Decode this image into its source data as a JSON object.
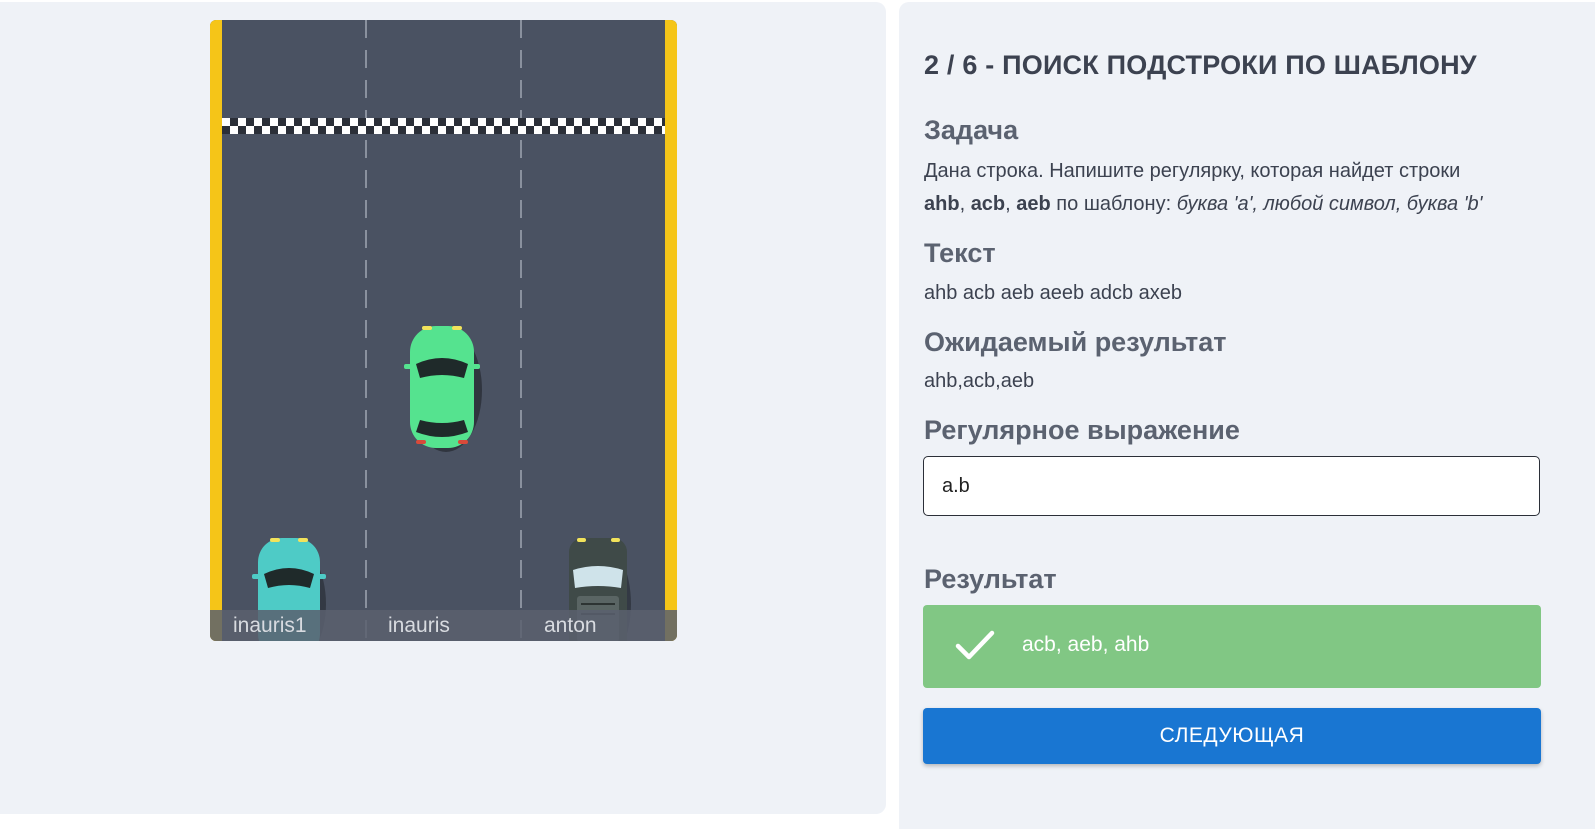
{
  "game": {
    "players": [
      {
        "name": "inauris1",
        "car_color": "#4ecbc6"
      },
      {
        "name": "inauris",
        "car_color": "#55e38f"
      },
      {
        "name": "anton",
        "car_color": "#3f4a48"
      }
    ],
    "colors": {
      "track": "#4a5262",
      "curb": "#f5c518"
    }
  },
  "task": {
    "title": "2 / 6 - ПОИСК ПОДСТРОКИ ПО ШАБЛОНУ",
    "task_heading": "Задача",
    "task_line1": "Дана строка. Напишите регулярку, которая найдет строки",
    "task_word1": "ahb",
    "task_sep1": ", ",
    "task_word2": "acb",
    "task_sep2": ", ",
    "task_word3": "aeb",
    "task_mid": " по шаблону: ",
    "task_pattern": "буква 'a', любой символ, буква 'b'",
    "text_heading": "Текст",
    "text_value": "ahb acb aeb aeeb adcb axeb",
    "expected_heading": "Ожидаемый результат",
    "expected_value": "ahb,acb,aeb",
    "regex_heading": "Регулярное выражение",
    "regex_value": "a.b",
    "result_heading": "Результат",
    "result_value": "acb, aeb, ahb",
    "result_color": "#81c784",
    "result_icon": "check-icon",
    "next_label": "СЛЕДУЮЩАЯ",
    "next_color": "#1976d2"
  }
}
